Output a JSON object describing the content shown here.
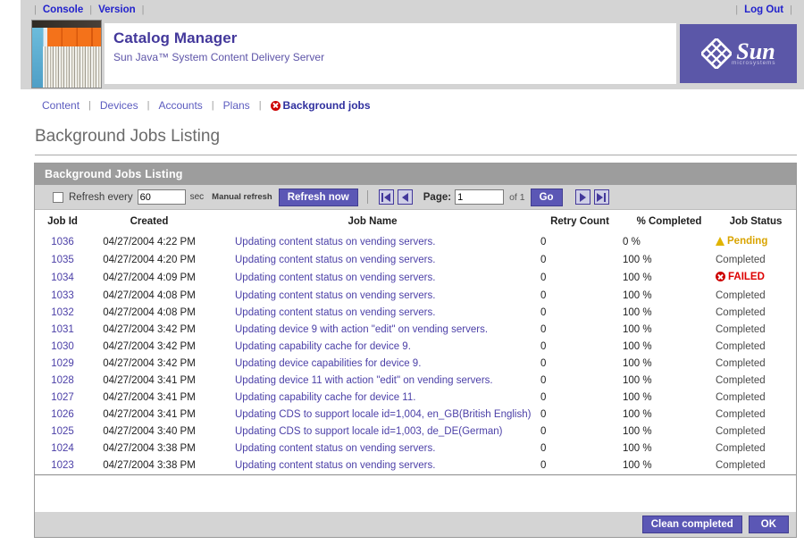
{
  "topbar": {
    "links": [
      "Console",
      "Version"
    ],
    "logout": "Log Out"
  },
  "branding": {
    "title": "Catalog Manager",
    "subtitle": "Sun Java™ System Content Delivery Server",
    "logo_word": "Sun",
    "logo_micro": "microsystems",
    "logo_color": "#5b57a8"
  },
  "nav": {
    "items": [
      {
        "label": "Content",
        "current": false
      },
      {
        "label": "Devices",
        "current": false
      },
      {
        "label": "Accounts",
        "current": false
      },
      {
        "label": "Plans",
        "current": false
      },
      {
        "label": "Background jobs",
        "current": true,
        "icon": "error-circle-icon"
      }
    ]
  },
  "page": {
    "heading": "Background Jobs Listing"
  },
  "panel": {
    "title": "Background Jobs Listing",
    "toolbar": {
      "refresh_checkbox_checked": false,
      "refresh_every_label": "Refresh every",
      "refresh_interval_value": "60",
      "sec_label": "sec",
      "manual_refresh_label": "Manual refresh",
      "refresh_now_label": "Refresh now",
      "page_label": "Page:",
      "page_value": "1",
      "of_label": "of 1",
      "go_label": "Go",
      "first_icon": "first-page-icon",
      "prev_icon": "previous-page-icon",
      "next_icon": "next-page-icon",
      "last_icon": "last-page-icon"
    },
    "table": {
      "headers": [
        "Job Id",
        "Created",
        "Job Name",
        "Retry Count",
        "% Completed",
        "Job Status"
      ],
      "rows": [
        {
          "id": "1036",
          "created": "04/27/2004 4:22 PM",
          "name": "Updating content status on vending servers.",
          "retry": "0",
          "pct": "0 %",
          "status": "Pending",
          "status_kind": "pending"
        },
        {
          "id": "1035",
          "created": "04/27/2004 4:20 PM",
          "name": "Updating content status on vending servers.",
          "retry": "0",
          "pct": "100 %",
          "status": "Completed",
          "status_kind": "completed"
        },
        {
          "id": "1034",
          "created": "04/27/2004 4:09 PM",
          "name": "Updating content status on vending servers.",
          "retry": "0",
          "pct": "100 %",
          "status": "FAILED",
          "status_kind": "failed"
        },
        {
          "id": "1033",
          "created": "04/27/2004 4:08 PM",
          "name": "Updating content status on vending servers.",
          "retry": "0",
          "pct": "100 %",
          "status": "Completed",
          "status_kind": "completed"
        },
        {
          "id": "1032",
          "created": "04/27/2004 4:08 PM",
          "name": "Updating content status on vending servers.",
          "retry": "0",
          "pct": "100 %",
          "status": "Completed",
          "status_kind": "completed"
        },
        {
          "id": "1031",
          "created": "04/27/2004 3:42 PM",
          "name": "Updating device 9 with action \"edit\" on vending servers.",
          "retry": "0",
          "pct": "100 %",
          "status": "Completed",
          "status_kind": "completed"
        },
        {
          "id": "1030",
          "created": "04/27/2004 3:42 PM",
          "name": "Updating capability cache for device 9.",
          "retry": "0",
          "pct": "100 %",
          "status": "Completed",
          "status_kind": "completed"
        },
        {
          "id": "1029",
          "created": "04/27/2004 3:42 PM",
          "name": "Updating device capabilities for device 9.",
          "retry": "0",
          "pct": "100 %",
          "status": "Completed",
          "status_kind": "completed"
        },
        {
          "id": "1028",
          "created": "04/27/2004 3:41 PM",
          "name": "Updating device 11 with action \"edit\" on vending servers.",
          "retry": "0",
          "pct": "100 %",
          "status": "Completed",
          "status_kind": "completed"
        },
        {
          "id": "1027",
          "created": "04/27/2004 3:41 PM",
          "name": "Updating capability cache for device 11.",
          "retry": "0",
          "pct": "100 %",
          "status": "Completed",
          "status_kind": "completed"
        },
        {
          "id": "1026",
          "created": "04/27/2004 3:41 PM",
          "name": "Updating CDS to support locale id=1,004, en_GB(British English)",
          "retry": "0",
          "pct": "100 %",
          "status": "Completed",
          "status_kind": "completed"
        },
        {
          "id": "1025",
          "created": "04/27/2004 3:40 PM",
          "name": "Updating CDS to support locale id=1,003, de_DE(German)",
          "retry": "0",
          "pct": "100 %",
          "status": "Completed",
          "status_kind": "completed"
        },
        {
          "id": "1024",
          "created": "04/27/2004 3:38 PM",
          "name": "Updating content status on vending servers.",
          "retry": "0",
          "pct": "100 %",
          "status": "Completed",
          "status_kind": "completed"
        },
        {
          "id": "1023",
          "created": "04/27/2004 3:38 PM",
          "name": "Updating content status on vending servers.",
          "retry": "0",
          "pct": "100 %",
          "status": "Completed",
          "status_kind": "completed"
        }
      ]
    },
    "footer": {
      "clean_completed_label": "Clean completed",
      "ok_label": "OK"
    }
  },
  "colors": {
    "accent": "#5b57b5",
    "link": "#4b3fa7",
    "pending": "#d9a400",
    "failed": "#dd0000",
    "panel_title_bg": "#9d9d9d",
    "toolbar_bg": "#d4d4d4"
  }
}
